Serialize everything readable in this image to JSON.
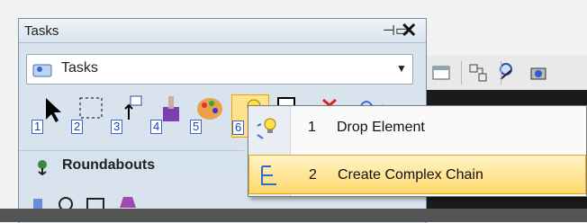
{
  "panel": {
    "title": "Tasks"
  },
  "dropdown": {
    "selected": "Tasks"
  },
  "tools": [
    {
      "num": "1",
      "icon": "select-arrow-icon"
    },
    {
      "num": "2",
      "icon": "selection-box-icon"
    },
    {
      "num": "3",
      "icon": "move-element-icon"
    },
    {
      "num": "4",
      "icon": "paint-bucket-icon"
    },
    {
      "num": "5",
      "icon": "palette-icon"
    },
    {
      "num": "6",
      "icon": "drop-bulb-icon"
    }
  ],
  "section": {
    "label": "Roundabouts"
  },
  "popup": {
    "items": [
      {
        "num": "1",
        "label": "Drop Element",
        "icon": "drop-element-icon"
      },
      {
        "num": "2",
        "label": "Create Complex Chain",
        "icon": "complex-chain-icon"
      }
    ]
  },
  "colors": {
    "highlight": "#ffd86a",
    "highlight_border": "#e3a51e",
    "panel_bg": "#d9e3ee"
  }
}
